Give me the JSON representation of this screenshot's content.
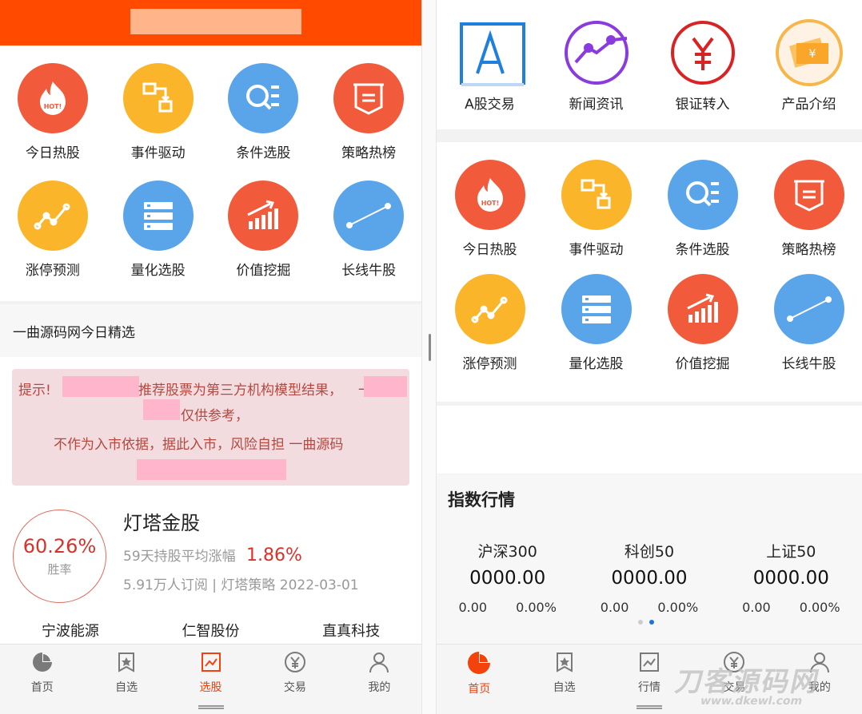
{
  "grid_items": [
    {
      "label": "今日热股",
      "icon": "hot-fire-icon",
      "color": "red"
    },
    {
      "label": "事件驱动",
      "icon": "flow-boxes-icon",
      "color": "yellow"
    },
    {
      "label": "条件选股",
      "icon": "search-list-icon",
      "color": "blue"
    },
    {
      "label": "策略热榜",
      "icon": "ribbon-badge-icon",
      "color": "red"
    },
    {
      "label": "涨停预测",
      "icon": "trend-line-icon",
      "color": "yellow"
    },
    {
      "label": "量化选股",
      "icon": "stacked-list-icon",
      "color": "blue"
    },
    {
      "label": "价值挖掘",
      "icon": "bar-growth-icon",
      "color": "red"
    },
    {
      "label": "长线牛股",
      "icon": "diagonal-line-icon",
      "color": "blue"
    }
  ],
  "hot_badge": "HOT!",
  "left": {
    "section_title": "一曲源码网今日精选",
    "tip": {
      "line1_prefix": "提示!",
      "line1_suffix": "推荐股票为第三方机构模型结果，",
      "line1_cut": "一",
      "line2": "仅供参考，",
      "line3": "不作为入市依据，据此入市，风险自担 一曲源码"
    },
    "stock": {
      "win_rate": "60.26%",
      "win_label": "胜率",
      "name": "灯塔金股",
      "avg_text": "59天持股平均涨幅",
      "avg_value": "1.86%",
      "meta": "5.91万人订阅 | 灯塔策略 2022-03-01",
      "picks": [
        "宁波能源",
        "仁智股份",
        "直真科技"
      ]
    },
    "tabs": [
      {
        "label": "首页",
        "icon": "pie-chart-icon",
        "active": false
      },
      {
        "label": "自选",
        "icon": "bookmark-star-icon",
        "active": false
      },
      {
        "label": "选股",
        "icon": "line-chart-icon",
        "active": true
      },
      {
        "label": "交易",
        "icon": "yen-coin-icon",
        "active": false
      },
      {
        "label": "我的",
        "icon": "user-icon",
        "active": false
      }
    ]
  },
  "right": {
    "top_items": [
      {
        "label": "A股交易",
        "icon": "a-share-icon"
      },
      {
        "label": "新闻资讯",
        "icon": "news-graph-icon"
      },
      {
        "label": "银证转入",
        "icon": "yen-circle-icon"
      },
      {
        "label": "产品介绍",
        "icon": "product-ticket-icon"
      }
    ],
    "index_title": "指数行情",
    "indices": [
      {
        "name": "沪深300",
        "value": "0000.00",
        "change": "0.00",
        "pct": "0.00%"
      },
      {
        "name": "科创50",
        "value": "0000.00",
        "change": "0.00",
        "pct": "0.00%"
      },
      {
        "name": "上证50",
        "value": "0000.00",
        "change": "0.00",
        "pct": "0.00%"
      }
    ],
    "tabs": [
      {
        "label": "首页",
        "icon": "pie-chart-icon",
        "active": true
      },
      {
        "label": "自选",
        "icon": "bookmark-star-icon",
        "active": false
      },
      {
        "label": "行情",
        "icon": "line-chart-icon",
        "active": false
      },
      {
        "label": "交易",
        "icon": "yen-coin-icon",
        "active": false
      },
      {
        "label": "我的",
        "icon": "user-icon",
        "active": false
      }
    ],
    "watermark": "刀客源码网",
    "watermark_url": "www.dkewl.com"
  }
}
